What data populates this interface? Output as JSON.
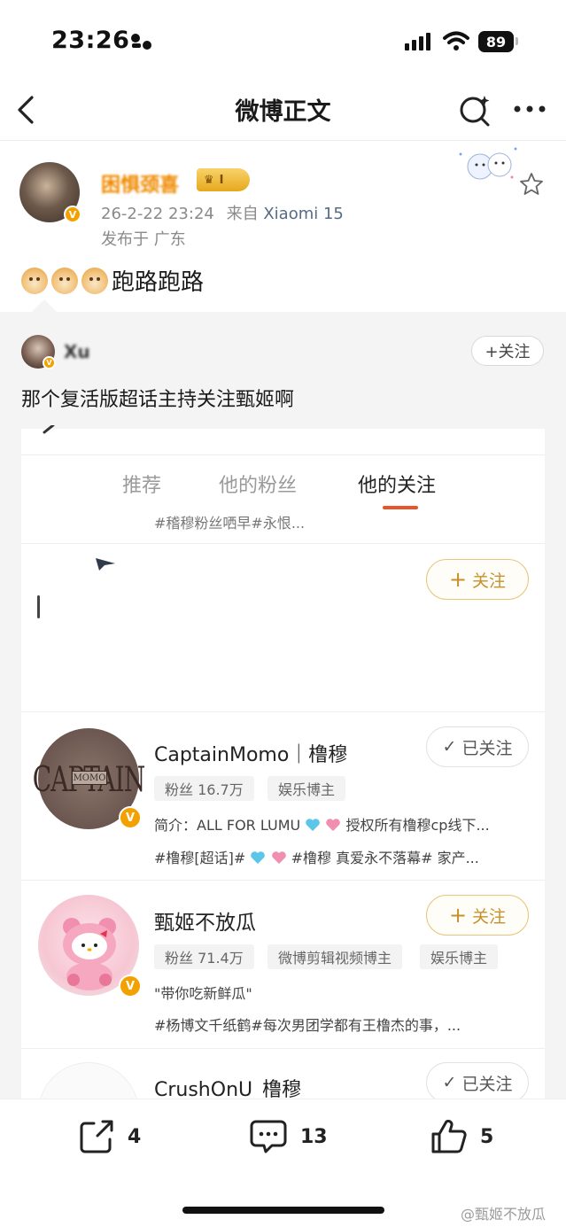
{
  "status_bar": {
    "time": "23:26",
    "battery": "89"
  },
  "nav": {
    "title": "微博正文"
  },
  "post": {
    "username": "困惧颈喜",
    "level_badge": "I",
    "time": "26-2-22 23:24",
    "source_prefix": "来自",
    "source": "Xiaomi 15",
    "location": "发布于 广东",
    "text": "跑路跑路"
  },
  "repost": {
    "username": "Xu",
    "follow_label": "+关注",
    "text": "那个复活版超话主持关注甄姬啊"
  },
  "embedded": {
    "tabs": [
      {
        "label": "推荐"
      },
      {
        "label": "他的粉丝"
      },
      {
        "label": "他的关注"
      }
    ],
    "tag_line": "#稽穆粉丝哂早#永恨...",
    "first_follow_label": "关注",
    "users": [
      {
        "name": "CaptainMomo｜橹穆",
        "button": "已关注",
        "chips": [
          "粉丝 16.7万",
          "娱乐博主"
        ],
        "desc_prefix": "简介：ALL FOR LUMU",
        "desc_suffix": "授权所有橹穆cp线下...",
        "tags_prefix": "#橹穆[超话]#",
        "tags_suffix": "#橹穆 真爱永不落幕# 家产..."
      },
      {
        "name": "甄姬不放瓜",
        "button": "关注",
        "chips": [
          "粉丝 71.4万",
          "微博剪辑视频博主",
          "娱乐博主"
        ],
        "desc": "\"带你吃新鲜瓜\"",
        "tags": "#杨博文千纸鹤#每次男团学都有王橹杰的事，..."
      },
      {
        "name": "CrushOnU_橹穆",
        "button": "已关注"
      }
    ]
  },
  "actions": {
    "share_count": "4",
    "comment_count": "13",
    "like_count": "5"
  },
  "watermark": "@甄姬不放瓜",
  "colors": {
    "accent_orange": "#e8552b",
    "follow_gold": "#c8902a",
    "verified": "#f2a100"
  }
}
